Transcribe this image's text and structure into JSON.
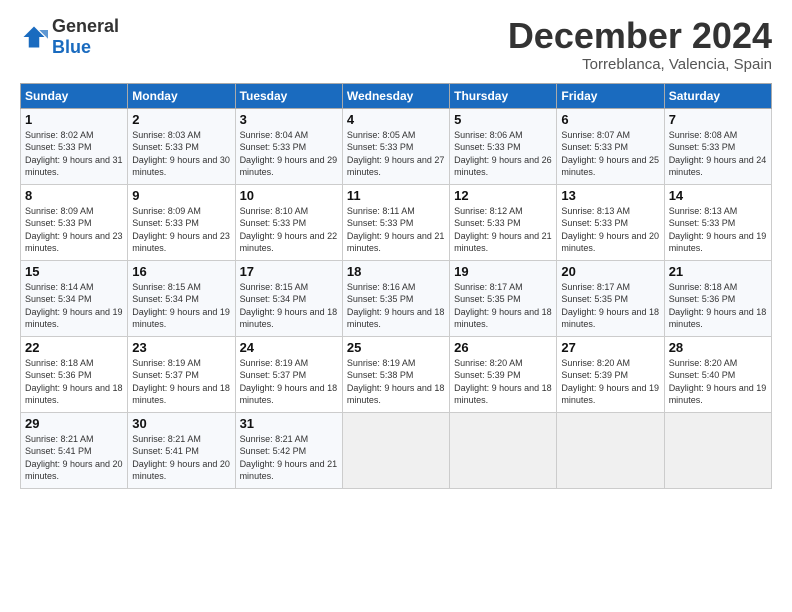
{
  "logo": {
    "line1": "General",
    "line2": "Blue"
  },
  "title": "December 2024",
  "subtitle": "Torreblanca, Valencia, Spain",
  "headers": [
    "Sunday",
    "Monday",
    "Tuesday",
    "Wednesday",
    "Thursday",
    "Friday",
    "Saturday"
  ],
  "weeks": [
    [
      {
        "day": "1",
        "sunrise": "8:02 AM",
        "sunset": "5:33 PM",
        "daylight": "9 hours and 31 minutes."
      },
      {
        "day": "2",
        "sunrise": "8:03 AM",
        "sunset": "5:33 PM",
        "daylight": "9 hours and 30 minutes."
      },
      {
        "day": "3",
        "sunrise": "8:04 AM",
        "sunset": "5:33 PM",
        "daylight": "9 hours and 29 minutes."
      },
      {
        "day": "4",
        "sunrise": "8:05 AM",
        "sunset": "5:33 PM",
        "daylight": "9 hours and 27 minutes."
      },
      {
        "day": "5",
        "sunrise": "8:06 AM",
        "sunset": "5:33 PM",
        "daylight": "9 hours and 26 minutes."
      },
      {
        "day": "6",
        "sunrise": "8:07 AM",
        "sunset": "5:33 PM",
        "daylight": "9 hours and 25 minutes."
      },
      {
        "day": "7",
        "sunrise": "8:08 AM",
        "sunset": "5:33 PM",
        "daylight": "9 hours and 24 minutes."
      }
    ],
    [
      {
        "day": "8",
        "sunrise": "8:09 AM",
        "sunset": "5:33 PM",
        "daylight": "9 hours and 23 minutes."
      },
      {
        "day": "9",
        "sunrise": "8:09 AM",
        "sunset": "5:33 PM",
        "daylight": "9 hours and 23 minutes."
      },
      {
        "day": "10",
        "sunrise": "8:10 AM",
        "sunset": "5:33 PM",
        "daylight": "9 hours and 22 minutes."
      },
      {
        "day": "11",
        "sunrise": "8:11 AM",
        "sunset": "5:33 PM",
        "daylight": "9 hours and 21 minutes."
      },
      {
        "day": "12",
        "sunrise": "8:12 AM",
        "sunset": "5:33 PM",
        "daylight": "9 hours and 21 minutes."
      },
      {
        "day": "13",
        "sunrise": "8:13 AM",
        "sunset": "5:33 PM",
        "daylight": "9 hours and 20 minutes."
      },
      {
        "day": "14",
        "sunrise": "8:13 AM",
        "sunset": "5:33 PM",
        "daylight": "9 hours and 19 minutes."
      }
    ],
    [
      {
        "day": "15",
        "sunrise": "8:14 AM",
        "sunset": "5:34 PM",
        "daylight": "9 hours and 19 minutes."
      },
      {
        "day": "16",
        "sunrise": "8:15 AM",
        "sunset": "5:34 PM",
        "daylight": "9 hours and 19 minutes."
      },
      {
        "day": "17",
        "sunrise": "8:15 AM",
        "sunset": "5:34 PM",
        "daylight": "9 hours and 18 minutes."
      },
      {
        "day": "18",
        "sunrise": "8:16 AM",
        "sunset": "5:35 PM",
        "daylight": "9 hours and 18 minutes."
      },
      {
        "day": "19",
        "sunrise": "8:17 AM",
        "sunset": "5:35 PM",
        "daylight": "9 hours and 18 minutes."
      },
      {
        "day": "20",
        "sunrise": "8:17 AM",
        "sunset": "5:35 PM",
        "daylight": "9 hours and 18 minutes."
      },
      {
        "day": "21",
        "sunrise": "8:18 AM",
        "sunset": "5:36 PM",
        "daylight": "9 hours and 18 minutes."
      }
    ],
    [
      {
        "day": "22",
        "sunrise": "8:18 AM",
        "sunset": "5:36 PM",
        "daylight": "9 hours and 18 minutes."
      },
      {
        "day": "23",
        "sunrise": "8:19 AM",
        "sunset": "5:37 PM",
        "daylight": "9 hours and 18 minutes."
      },
      {
        "day": "24",
        "sunrise": "8:19 AM",
        "sunset": "5:37 PM",
        "daylight": "9 hours and 18 minutes."
      },
      {
        "day": "25",
        "sunrise": "8:19 AM",
        "sunset": "5:38 PM",
        "daylight": "9 hours and 18 minutes."
      },
      {
        "day": "26",
        "sunrise": "8:20 AM",
        "sunset": "5:39 PM",
        "daylight": "9 hours and 18 minutes."
      },
      {
        "day": "27",
        "sunrise": "8:20 AM",
        "sunset": "5:39 PM",
        "daylight": "9 hours and 19 minutes."
      },
      {
        "day": "28",
        "sunrise": "8:20 AM",
        "sunset": "5:40 PM",
        "daylight": "9 hours and 19 minutes."
      }
    ],
    [
      {
        "day": "29",
        "sunrise": "8:21 AM",
        "sunset": "5:41 PM",
        "daylight": "9 hours and 20 minutes."
      },
      {
        "day": "30",
        "sunrise": "8:21 AM",
        "sunset": "5:41 PM",
        "daylight": "9 hours and 20 minutes."
      },
      {
        "day": "31",
        "sunrise": "8:21 AM",
        "sunset": "5:42 PM",
        "daylight": "9 hours and 21 minutes."
      },
      null,
      null,
      null,
      null
    ]
  ]
}
